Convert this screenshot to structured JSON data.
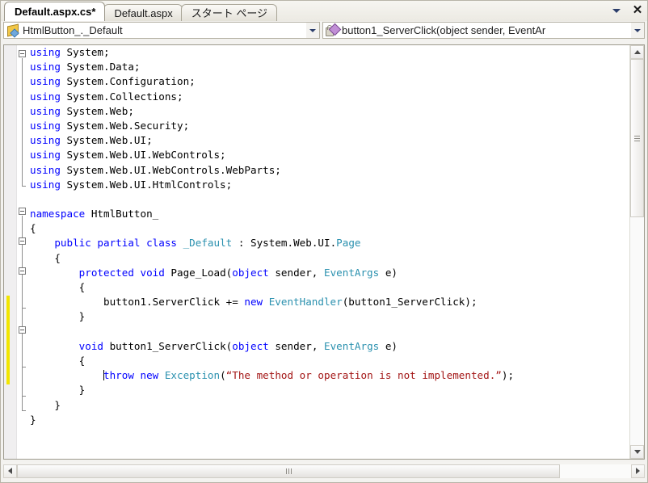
{
  "window": {
    "tabs": [
      {
        "label": "Default.aspx.cs*",
        "active": true
      },
      {
        "label": "Default.aspx",
        "active": false
      },
      {
        "label": "スタート ページ",
        "active": false
      }
    ],
    "tab_dropdown_icon": "chevron-down-icon",
    "tab_close_icon": "close-icon"
  },
  "navbar": {
    "class_combo": {
      "icon": "class-icon",
      "value": "HtmlButton_._Default",
      "arrow_icon": "chevron-down-icon"
    },
    "member_combo": {
      "icon": "method-private-icon",
      "value": "button1_ServerClick(object sender, EventAr",
      "arrow_icon": "chevron-down-icon"
    }
  },
  "editor": {
    "language": "csharp",
    "colors": {
      "keyword": "#0000ff",
      "type": "#2b91af",
      "string": "#a31515",
      "text": "#000000",
      "change_bar": "#f2e600"
    },
    "lines": [
      [
        {
          "t": "using",
          "c": "kw"
        },
        {
          "t": " System;",
          "c": ""
        }
      ],
      [
        {
          "t": "using",
          "c": "kw"
        },
        {
          "t": " System.Data;",
          "c": ""
        }
      ],
      [
        {
          "t": "using",
          "c": "kw"
        },
        {
          "t": " System.Configuration;",
          "c": ""
        }
      ],
      [
        {
          "t": "using",
          "c": "kw"
        },
        {
          "t": " System.Collections;",
          "c": ""
        }
      ],
      [
        {
          "t": "using",
          "c": "kw"
        },
        {
          "t": " System.Web;",
          "c": ""
        }
      ],
      [
        {
          "t": "using",
          "c": "kw"
        },
        {
          "t": " System.Web.Security;",
          "c": ""
        }
      ],
      [
        {
          "t": "using",
          "c": "kw"
        },
        {
          "t": " System.Web.UI;",
          "c": ""
        }
      ],
      [
        {
          "t": "using",
          "c": "kw"
        },
        {
          "t": " System.Web.UI.WebControls;",
          "c": ""
        }
      ],
      [
        {
          "t": "using",
          "c": "kw"
        },
        {
          "t": " System.Web.UI.WebControls.WebParts;",
          "c": ""
        }
      ],
      [
        {
          "t": "using",
          "c": "kw"
        },
        {
          "t": " System.Web.UI.HtmlControls;",
          "c": ""
        }
      ],
      [],
      [
        {
          "t": "namespace",
          "c": "kw"
        },
        {
          "t": " HtmlButton_",
          "c": ""
        }
      ],
      [
        {
          "t": "{",
          "c": ""
        }
      ],
      [
        {
          "t": "    ",
          "c": ""
        },
        {
          "t": "public partial class",
          "c": "kw"
        },
        {
          "t": " ",
          "c": ""
        },
        {
          "t": "_Default",
          "c": "ty"
        },
        {
          "t": " : System.Web.UI.",
          "c": ""
        },
        {
          "t": "Page",
          "c": "ty"
        }
      ],
      [
        {
          "t": "    {",
          "c": ""
        }
      ],
      [
        {
          "t": "        ",
          "c": ""
        },
        {
          "t": "protected void",
          "c": "kw"
        },
        {
          "t": " Page_Load(",
          "c": ""
        },
        {
          "t": "object",
          "c": "kw"
        },
        {
          "t": " sender, ",
          "c": ""
        },
        {
          "t": "EventArgs",
          "c": "ty"
        },
        {
          "t": " e)",
          "c": ""
        }
      ],
      [
        {
          "t": "        {",
          "c": ""
        }
      ],
      [
        {
          "t": "            button1.ServerClick += ",
          "c": ""
        },
        {
          "t": "new",
          "c": "kw"
        },
        {
          "t": " ",
          "c": ""
        },
        {
          "t": "EventHandler",
          "c": "ty"
        },
        {
          "t": "(button1_ServerClick);",
          "c": ""
        }
      ],
      [
        {
          "t": "        }",
          "c": ""
        }
      ],
      [],
      [
        {
          "t": "        ",
          "c": ""
        },
        {
          "t": "void",
          "c": "kw"
        },
        {
          "t": " button1_ServerClick(",
          "c": ""
        },
        {
          "t": "object",
          "c": "kw"
        },
        {
          "t": " sender, ",
          "c": ""
        },
        {
          "t": "EventArgs",
          "c": "ty"
        },
        {
          "t": " e)",
          "c": ""
        }
      ],
      [
        {
          "t": "        {",
          "c": ""
        }
      ],
      [
        {
          "t": "            ",
          "c": ""
        },
        {
          "t": "|CURSOR|",
          "c": "cur"
        },
        {
          "t": "throw new",
          "c": "kw"
        },
        {
          "t": " ",
          "c": ""
        },
        {
          "t": "Exception",
          "c": "ty"
        },
        {
          "t": "(",
          "c": ""
        },
        {
          "t": "“The method or operation is not implemented.”",
          "c": "st"
        },
        {
          "t": ");",
          "c": ""
        }
      ],
      [
        {
          "t": "        }",
          "c": ""
        }
      ],
      [
        {
          "t": "    }",
          "c": ""
        }
      ],
      [
        {
          "t": "}",
          "c": ""
        }
      ]
    ]
  },
  "scrollbars": {
    "vertical": {
      "up_icon": "scroll-up-icon",
      "down_icon": "scroll-down-icon",
      "thumb": "vertical-scroll-thumb"
    },
    "horizontal": {
      "left_icon": "scroll-left-icon",
      "right_icon": "scroll-right-icon",
      "thumb": "horizontal-scroll-thumb"
    }
  }
}
